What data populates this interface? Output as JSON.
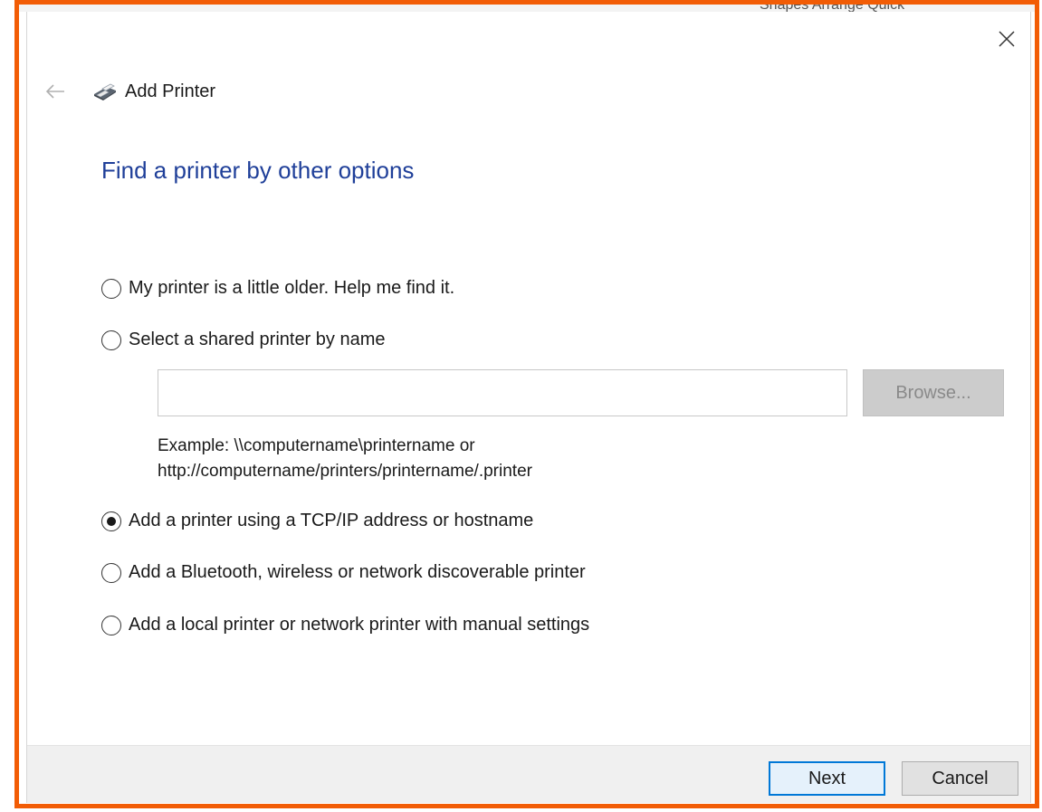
{
  "window": {
    "title": "Add Printer",
    "behind_text": "Shapes Arrange Quick"
  },
  "page": {
    "title": "Find a printer by other options"
  },
  "options": [
    {
      "label": "My printer is a little older. Help me find it.",
      "selected": false
    },
    {
      "label": "Select a shared printer by name",
      "selected": false
    },
    {
      "label": "Add a printer using a TCP/IP address or hostname",
      "selected": true
    },
    {
      "label": "Add a Bluetooth, wireless or network discoverable printer",
      "selected": false
    },
    {
      "label": "Add a local printer or network printer with manual settings",
      "selected": false
    }
  ],
  "shared_printer": {
    "value": "",
    "placeholder": "",
    "browse_label": "Browse...",
    "example_line1": "Example: \\\\computername\\printername or",
    "example_line2": "http://computername/printers/printername/.printer"
  },
  "footer": {
    "next_label": "Next",
    "cancel_label": "Cancel"
  },
  "colors": {
    "accent_title": "#1f3f99",
    "highlight_border": "#f25c05",
    "next_border": "#0078d7"
  },
  "icons": {
    "close": "close-icon",
    "back": "back-arrow-icon",
    "printer": "printer-icon"
  }
}
